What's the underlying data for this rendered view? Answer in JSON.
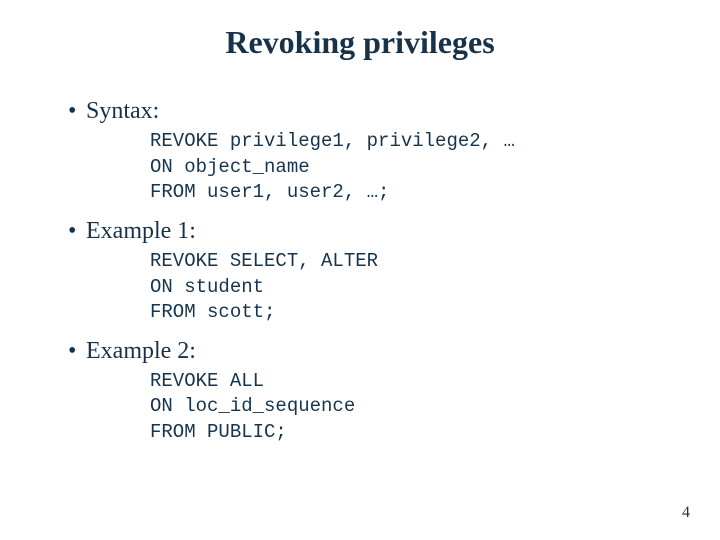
{
  "title": "Revoking privileges",
  "bullets": [
    {
      "label": "Syntax:",
      "code": "REVOKE privilege1, privilege2, …\nON object_name\nFROM user1, user2, …;"
    },
    {
      "label": "Example 1:",
      "code": "REVOKE SELECT, ALTER\nON student\nFROM scott;"
    },
    {
      "label": "Example 2:",
      "code": "REVOKE ALL\nON loc_id_sequence\nFROM PUBLIC;"
    }
  ],
  "page_number": "4"
}
